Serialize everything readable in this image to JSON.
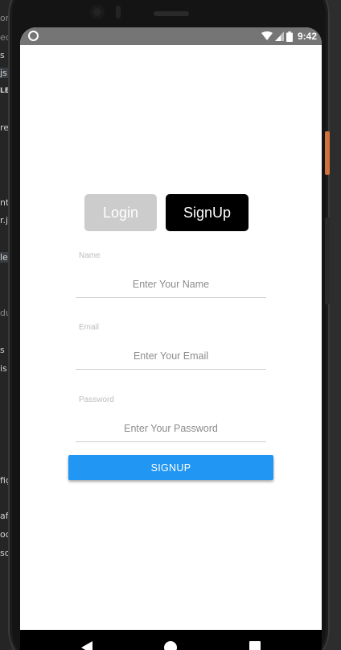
{
  "editor_fragments": [
    {
      "text": "or",
      "style": "dim"
    },
    {
      "text": "ec",
      "style": "dim"
    },
    {
      "text": "s",
      "style": ""
    },
    {
      "text": "js",
      "style": "hl"
    },
    {
      "text": "LE",
      "style": "bold"
    },
    {
      "text": "re",
      "style": ""
    },
    {
      "text": "nt",
      "style": ""
    },
    {
      "text": "r.js",
      "style": ""
    },
    {
      "text": "le",
      "style": "hl"
    },
    {
      "text": "du",
      "style": "dim"
    },
    {
      "text": "s",
      "style": ""
    },
    {
      "text": "is",
      "style": ""
    },
    {
      "text": "fiç",
      "style": ""
    },
    {
      "text": "afi",
      "style": ""
    },
    {
      "text": "od",
      "style": ""
    },
    {
      "text": "so",
      "style": ""
    }
  ],
  "status_bar": {
    "time": "9:42",
    "left_icon": "circle-icon",
    "icons": [
      "wifi-icon",
      "signal-icon",
      "battery-icon"
    ],
    "background": "#757575"
  },
  "auth_tabs": {
    "login_label": "Login",
    "signup_label": "SignUp",
    "active": "signup",
    "active_color": "#000000",
    "inactive_color": "#cccccc"
  },
  "form": {
    "fields": [
      {
        "label": "Name",
        "placeholder": "Enter Your Name",
        "value": ""
      },
      {
        "label": "Email",
        "placeholder": "Enter Your Email",
        "value": ""
      },
      {
        "label": "Password",
        "placeholder": "Enter Your Password",
        "value": ""
      }
    ],
    "submit_label": "SIGNUP",
    "submit_color": "#2196f3"
  },
  "nav_bar": {
    "icons": [
      "back-icon",
      "home-icon",
      "recents-icon"
    ]
  }
}
